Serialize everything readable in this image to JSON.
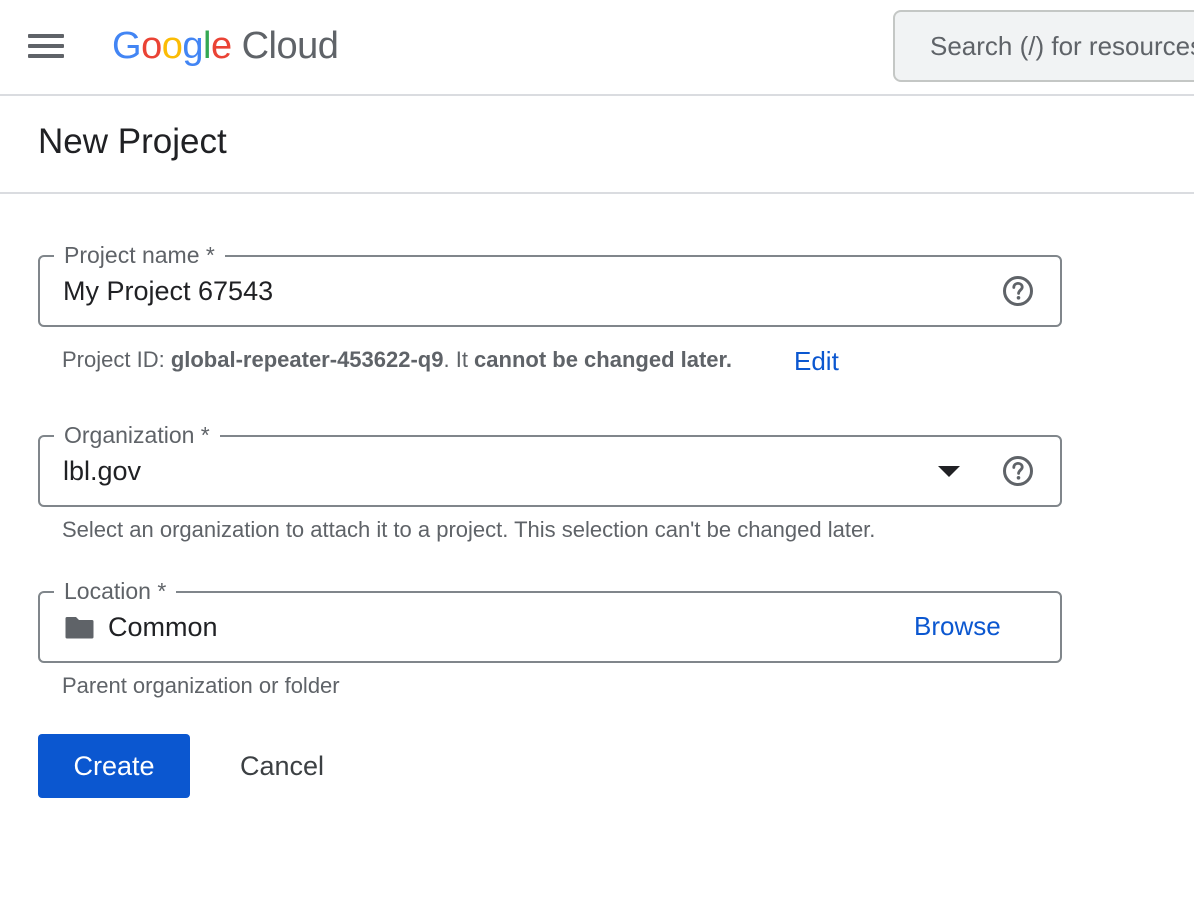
{
  "header": {
    "menu_icon": "hamburger-menu-icon",
    "logo": {
      "letters": [
        {
          "char": "G",
          "color": "#4285F4"
        },
        {
          "char": "o",
          "color": "#EA4335"
        },
        {
          "char": "o",
          "color": "#FBBC05"
        },
        {
          "char": "g",
          "color": "#4285F4"
        },
        {
          "char": "l",
          "color": "#34A853"
        },
        {
          "char": "e",
          "color": "#EA4335"
        }
      ],
      "suffix": "Cloud"
    },
    "search_placeholder": "Search (/) for resources"
  },
  "page": {
    "title": "New Project"
  },
  "form": {
    "project_name": {
      "label": "Project name *",
      "value": "My Project 67543",
      "help_icon": "help-circle-icon"
    },
    "project_id": {
      "prefix": "Project ID: ",
      "id": "global-repeater-453622-q9",
      "middle": ". It ",
      "emphasis": "cannot be changed later.",
      "edit_label": "Edit"
    },
    "organization": {
      "label": "Organization *",
      "value": "lbl.gov",
      "dropdown_icon": "arrow-drop-down-icon",
      "help_icon": "help-circle-icon",
      "hint": "Select an organization to attach it to a project. This selection can't be changed later."
    },
    "location": {
      "label": "Location *",
      "value": "Common",
      "folder_icon": "folder-icon",
      "browse_label": "Browse",
      "hint": "Parent organization or folder"
    }
  },
  "actions": {
    "create_label": "Create",
    "cancel_label": "Cancel"
  },
  "colors": {
    "primary": "#0b57d0",
    "outline": "#80868b",
    "muted_text": "#5f6368"
  }
}
